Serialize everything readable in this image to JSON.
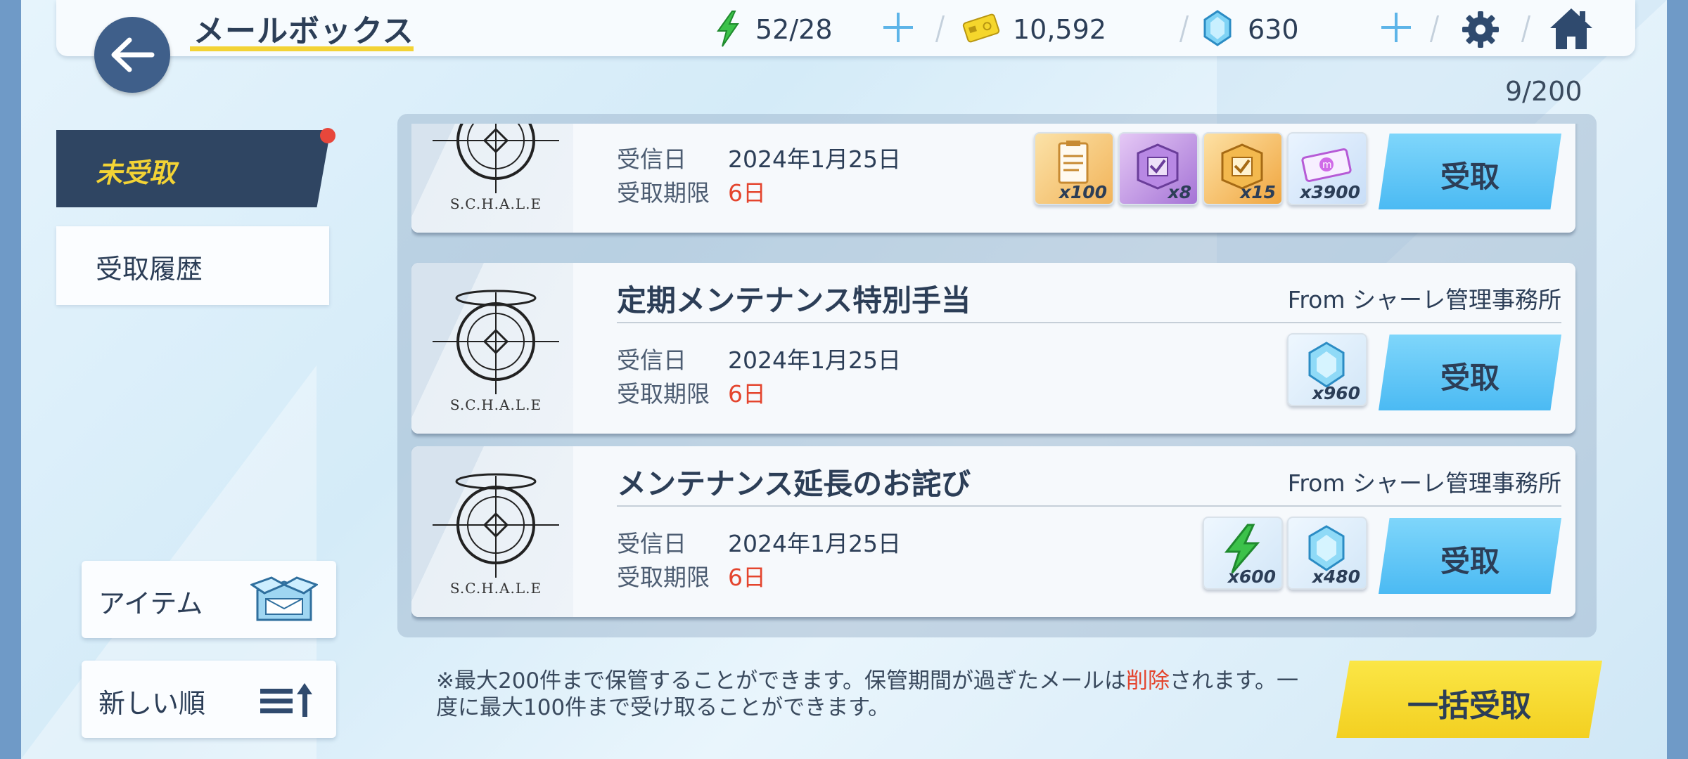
{
  "header": {
    "title": "メールボックス",
    "stamina": "52/28",
    "credits": "10,592",
    "gems": "630"
  },
  "mail_count": "9/200",
  "tabs": {
    "unclaimed": "未受取",
    "history": "受取履歴"
  },
  "side": {
    "items_label": "アイテム",
    "sort_label": "新しい順"
  },
  "labels": {
    "received": "受信日",
    "deadline": "受取期限",
    "claim": "受取",
    "emblem": "S.C.H.A.L.E"
  },
  "mails": [
    {
      "subject": "",
      "from": "",
      "date": "2024年1月25日",
      "deadline": "6日",
      "rewards": [
        {
          "icon": "report-item-icon",
          "qty": "x100"
        },
        {
          "icon": "purple-box-icon",
          "qty": "x8"
        },
        {
          "icon": "orange-box-icon",
          "qty": "x15"
        },
        {
          "icon": "ticket-icon",
          "qty": "x3900"
        }
      ]
    },
    {
      "subject": "定期メンテナンス特別手当",
      "from": "From シャーレ管理事務所",
      "date": "2024年1月25日",
      "deadline": "6日",
      "rewards": [
        {
          "icon": "gem-icon",
          "qty": "x960"
        }
      ]
    },
    {
      "subject": "メンテナンス延長のお詫び",
      "from": "From シャーレ管理事務所",
      "date": "2024年1月25日",
      "deadline": "6日",
      "rewards": [
        {
          "icon": "stamina-icon",
          "qty": "x600"
        },
        {
          "icon": "gem-icon",
          "qty": "x480"
        }
      ]
    }
  ],
  "footer": {
    "note_part1": "※最大200件まで保管することができます。保管期間が過ぎたメールは",
    "note_red": "削除",
    "note_part2": "されます。一度に最大100件まで受け取ることができます。",
    "bulk_claim": "一括受取"
  }
}
